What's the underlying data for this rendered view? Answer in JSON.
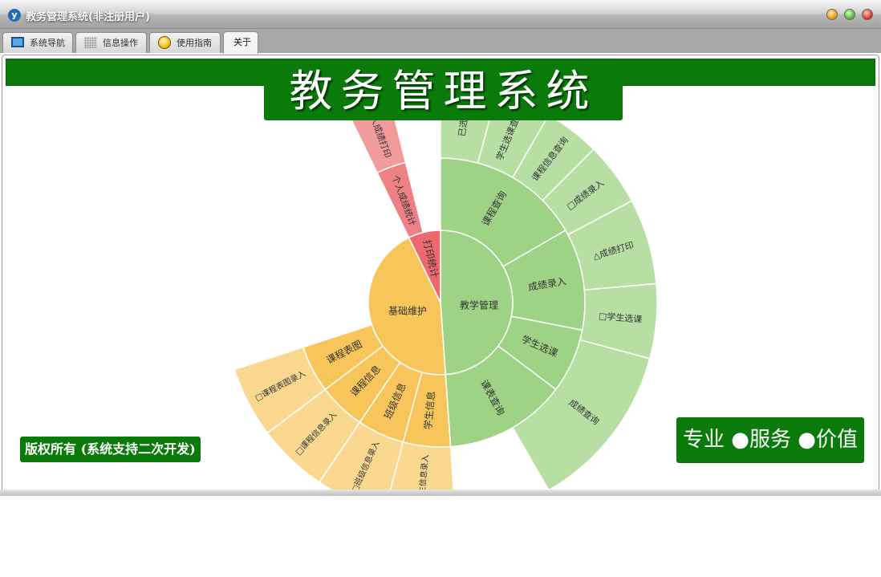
{
  "window": {
    "title": "教务管理系统(非注册用户)"
  },
  "tabs": [
    {
      "label": "系统导航",
      "icon": "monitor-icon"
    },
    {
      "label": "信息操作",
      "icon": "grid-icon"
    },
    {
      "label": "使用指南",
      "icon": "guide-icon"
    },
    {
      "label": "关于",
      "active": true
    }
  ],
  "about": {
    "banner": "教务管理系统",
    "copyright": "版权所有 (系统支持二次开发)",
    "slogan": "专业 ●服务 ●价值"
  },
  "colors": {
    "brand_green": "#0a7a0a",
    "green_inner": "#9ed385",
    "green_outer": "#b7dfa3",
    "red_inner": "#ec6a6e",
    "red_outer": "#f29b9b",
    "yellow_inner": "#f7c55a",
    "yellow_outer": "#fad890"
  },
  "sunburst": {
    "groups": [
      {
        "name": "教学管理",
        "children": [
          {
            "name": "课程查询",
            "children": [
              "已选课",
              "学生选课查询",
              "课程信息查询"
            ]
          },
          {
            "name": "成绩录入",
            "children": [
              "□成绩录入",
              "△成绩打印"
            ]
          },
          {
            "name": "学生选课",
            "children": [
              "□学生选课"
            ]
          },
          {
            "name": "课表查询",
            "children": [
              "成绩查询"
            ]
          }
        ]
      },
      {
        "name": "基础维护",
        "children": [
          {
            "name": "学生信息",
            "children": [
              "□学生信息录入"
            ]
          },
          {
            "name": "班级信息",
            "children": [
              "□班级信息录入"
            ]
          },
          {
            "name": "课程信息",
            "children": [
              "□课程信息录入"
            ]
          },
          {
            "name": "课程表图",
            "children": [
              "□课程表图录入"
            ]
          }
        ]
      },
      {
        "name": "打印统计",
        "children": [
          {
            "name": "个人成绩统计",
            "children": [
              "个人成绩打印"
            ]
          }
        ]
      }
    ]
  }
}
